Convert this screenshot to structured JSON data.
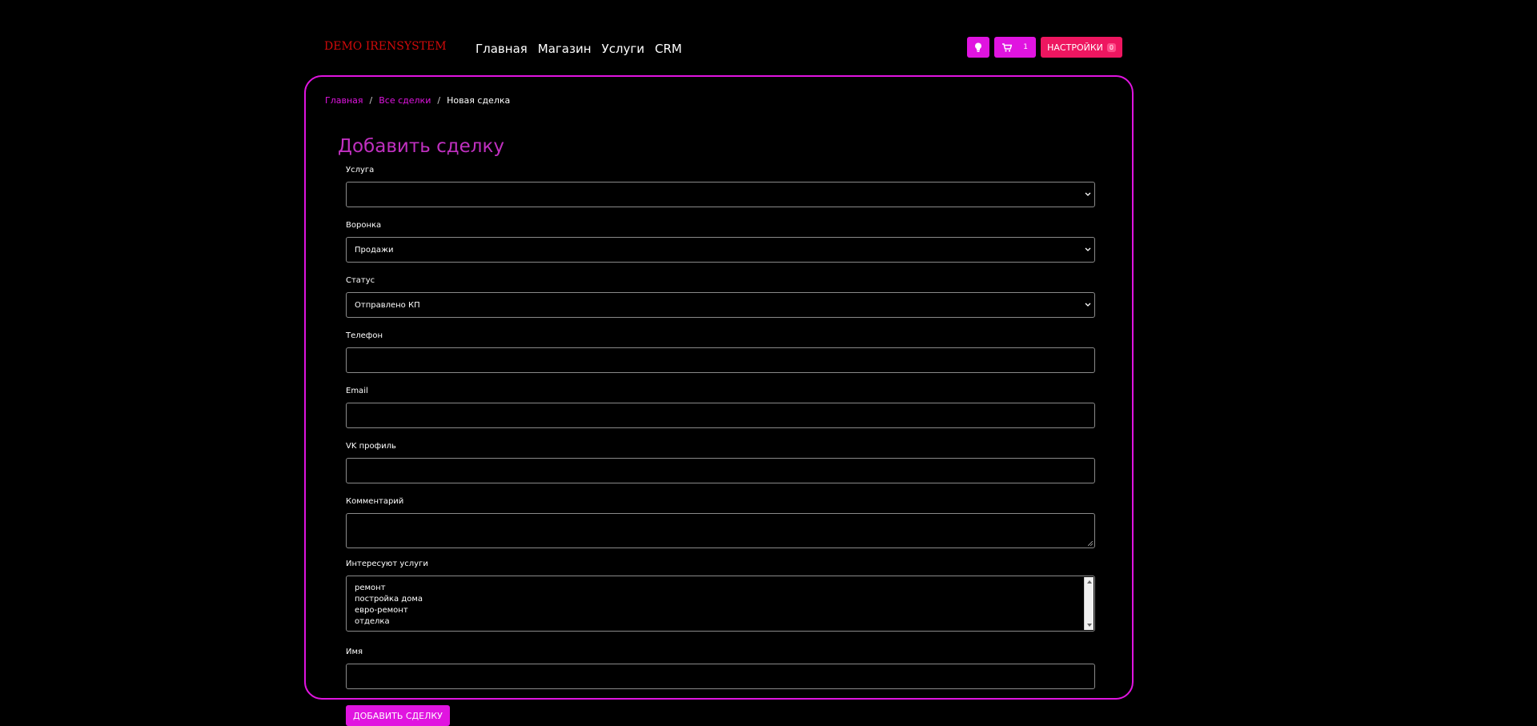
{
  "header": {
    "brand": "DEMO IRENSYSTEM",
    "nav": [
      {
        "label": "Главная"
      },
      {
        "label": "Магазин"
      },
      {
        "label": "Услуги"
      },
      {
        "label": "CRM"
      }
    ],
    "cart_count": "1",
    "settings_label": "НАСТРОЙКИ",
    "settings_badge": "0",
    "icons": {
      "idea": "lightbulb-icon",
      "cart": "cart-icon"
    }
  },
  "breadcrumb": {
    "home": "Главная",
    "all_deals": "Все сделки",
    "current": "Новая сделка"
  },
  "form": {
    "title": "Добавить сделку",
    "service_label": "Услуга",
    "service_value": "",
    "funnel_label": "Воронка",
    "funnel_value": "Продажи",
    "status_label": "Статус",
    "status_value": "Отправлено КП",
    "phone_label": "Телефон",
    "phone_value": "",
    "email_label": "Email",
    "email_value": "",
    "vk_label": "VK профиль",
    "vk_value": "",
    "comment_label": "Комментарий",
    "comment_value": "",
    "interests_label": "Интересуют услуги",
    "interests_options": [
      "ремонт",
      "постройка дома",
      "евро-ремонт",
      "отделка"
    ],
    "name_label": "Имя",
    "name_value": "",
    "submit_label": "ДОБАВИТЬ СДЕЛКУ"
  },
  "colors": {
    "accent": "#e014e0",
    "brand": "#d10a0a",
    "settings": "#ee1660",
    "title": "#c030c0",
    "background": "#000000"
  }
}
